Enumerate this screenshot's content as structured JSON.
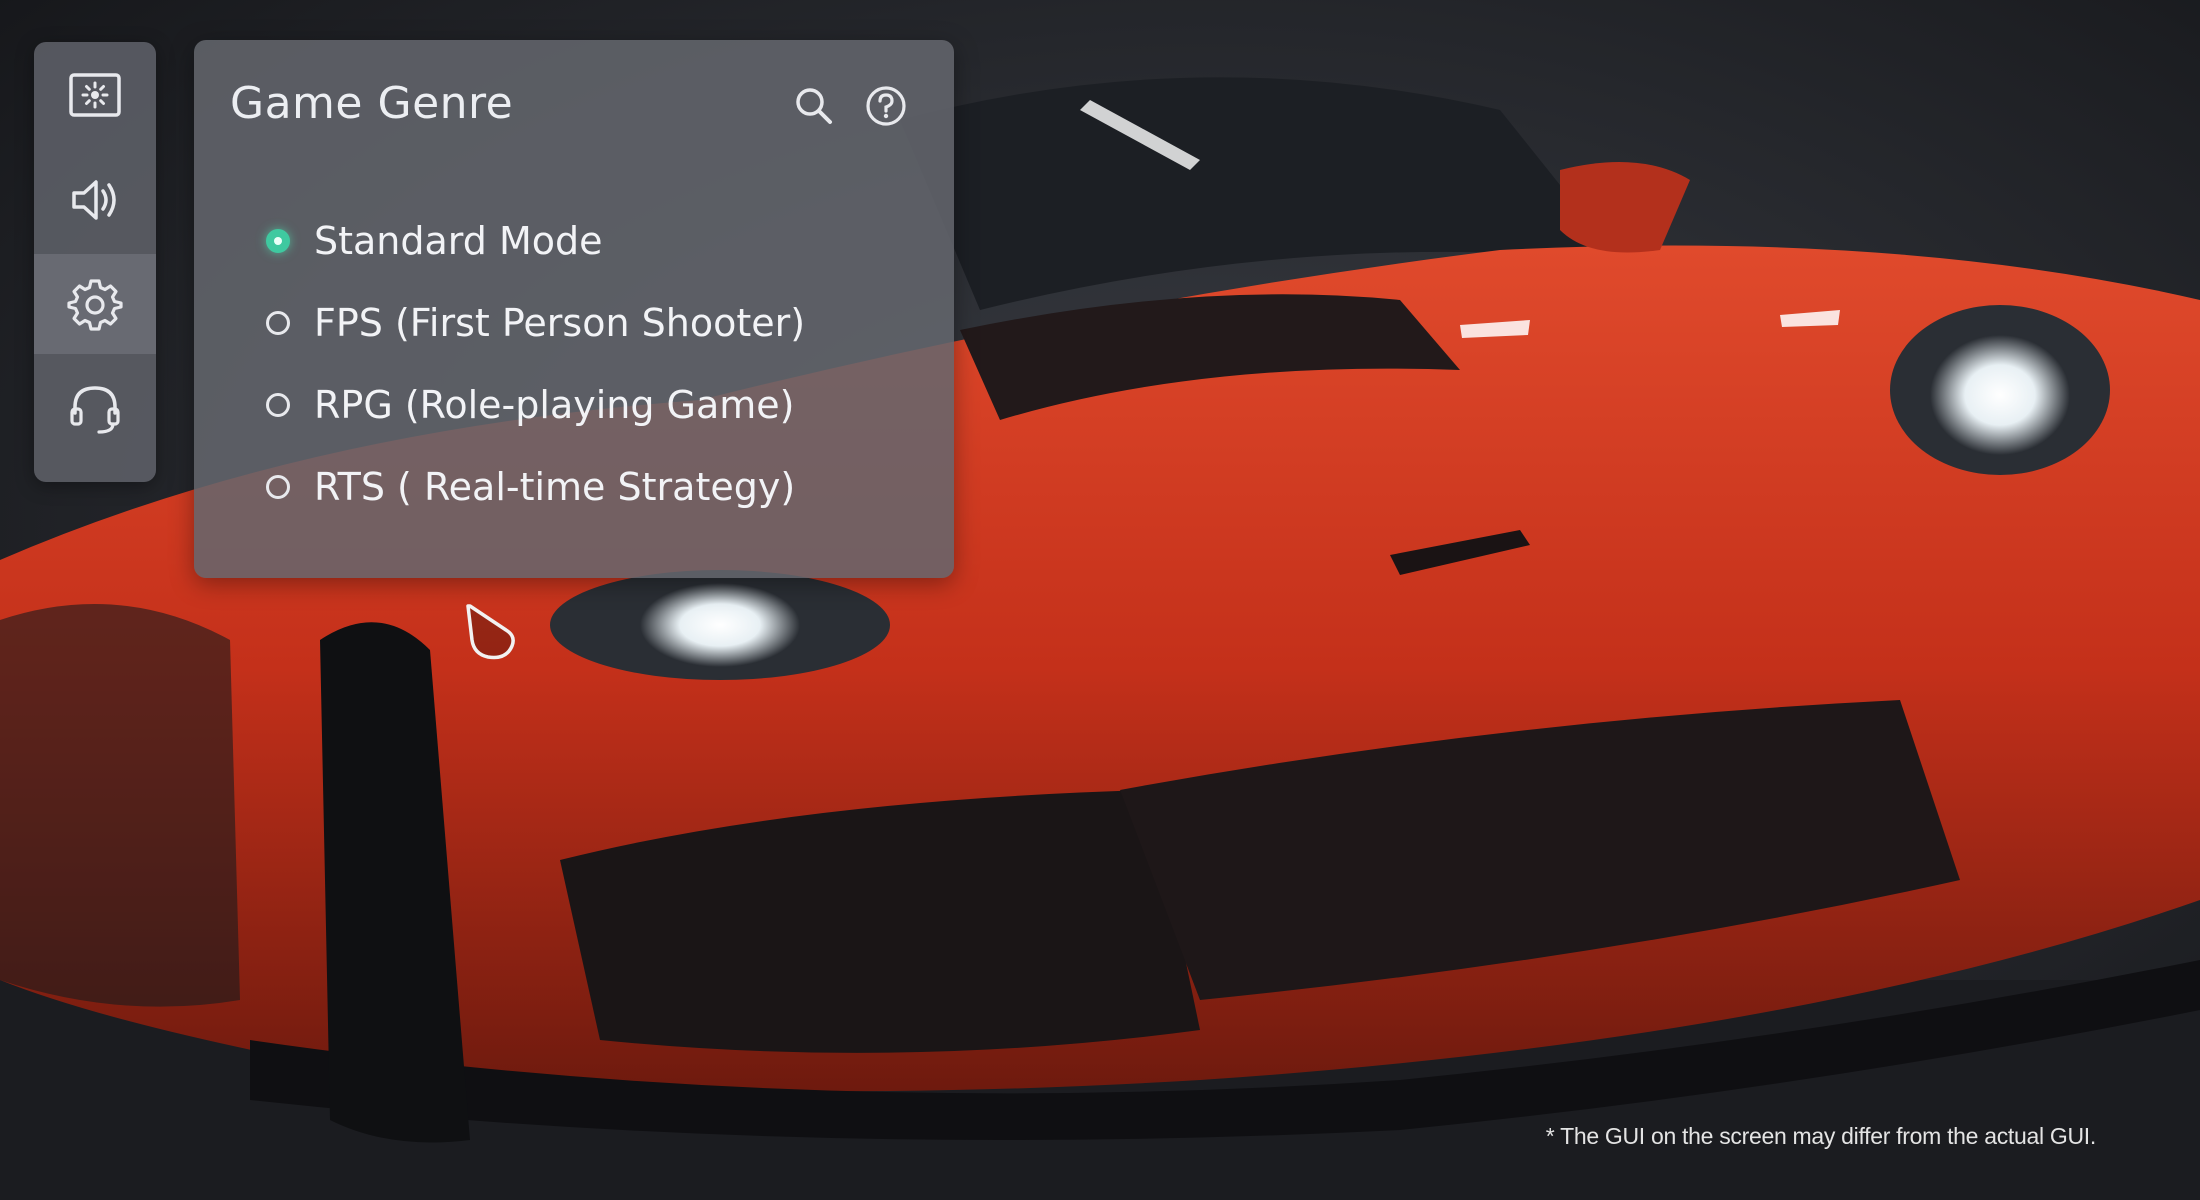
{
  "sidebar": {
    "items": [
      {
        "icon": "picture-icon",
        "active": false
      },
      {
        "icon": "speaker-icon",
        "active": false
      },
      {
        "icon": "gear-icon",
        "active": true
      },
      {
        "icon": "headset-icon",
        "active": false
      }
    ]
  },
  "panel": {
    "title": "Game Genre",
    "header_icons": [
      "search-icon",
      "help-icon"
    ],
    "options": [
      {
        "label": "Standard Mode",
        "selected": true
      },
      {
        "label": "FPS (First Person Shooter)",
        "selected": false
      },
      {
        "label": "RPG (Role-playing Game)",
        "selected": false
      },
      {
        "label": "RTS ( Real-time Strategy)",
        "selected": false
      }
    ]
  },
  "colors": {
    "accent": "#3fc9a0",
    "panel": "#64666e",
    "car": "#c8321c"
  },
  "footer": {
    "disclaimer": "* The GUI on the screen may differ from the actual GUI."
  }
}
